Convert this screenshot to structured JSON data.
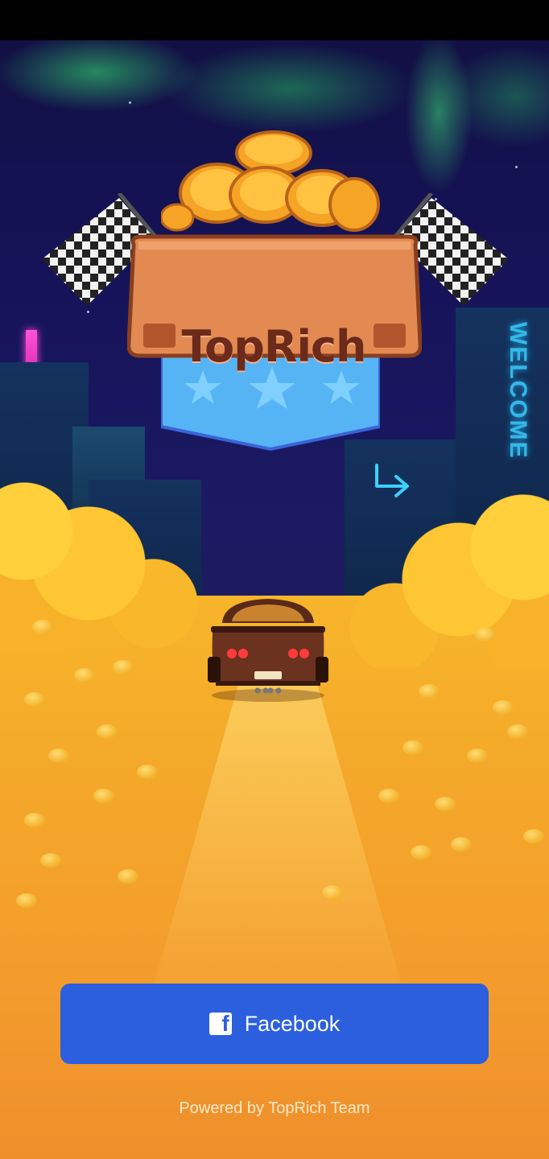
{
  "logo": {
    "title": "TopRich"
  },
  "scene": {
    "sign_text": "WELCOME"
  },
  "login": {
    "facebook_label": "Facebook",
    "facebook_icon": "facebook-icon"
  },
  "footer": {
    "text": "Powered by TopRich Team"
  },
  "colors": {
    "button": "#2b5fde",
    "gold": "#f4a72a",
    "sky": "#16135a"
  }
}
